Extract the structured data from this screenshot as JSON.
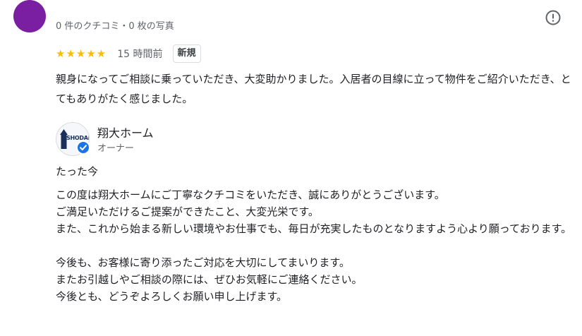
{
  "review": {
    "meta": "0 件のクチコミ・0 枚の写真",
    "stars": "★★★★★",
    "rating": 5,
    "time_ago": "15 時間前",
    "badge": "新規",
    "text": "親身になってご相談に乗っていただき、大変助かりました。入居者の目線に立って物件をご紹介いただき、とてもありがたく感じました。"
  },
  "owner_reply": {
    "name": "翔大ホーム",
    "role": "オーナー",
    "logo_text": "SHODAI",
    "time_ago": "たった今",
    "paragraph1": [
      "この度は翔大ホームにご丁寧なクチコミをいただき、誠にありがとうございます。",
      "ご満足いただけるご提案ができたこと、大変光栄です。",
      "また、これから始まる新しい環境やお仕事でも、毎日が充実したものとなりますよう心より願っております。"
    ],
    "paragraph2": [
      "今後も、お客様に寄り添ったご対応を大切にしてまいります。",
      "またお引越しやご相談の際には、ぜひお気軽にご連絡ください。",
      "今後とも、どうぞよろしくお願い申し上げます。"
    ]
  },
  "icons": {
    "report": "report-flag-icon",
    "verified": "verified-check-icon",
    "star": "star-icon"
  },
  "colors": {
    "avatar": "#7b1fa2",
    "star": "#fbbc04",
    "verified": "#1a73e8",
    "secondary_text": "#5f6368"
  }
}
